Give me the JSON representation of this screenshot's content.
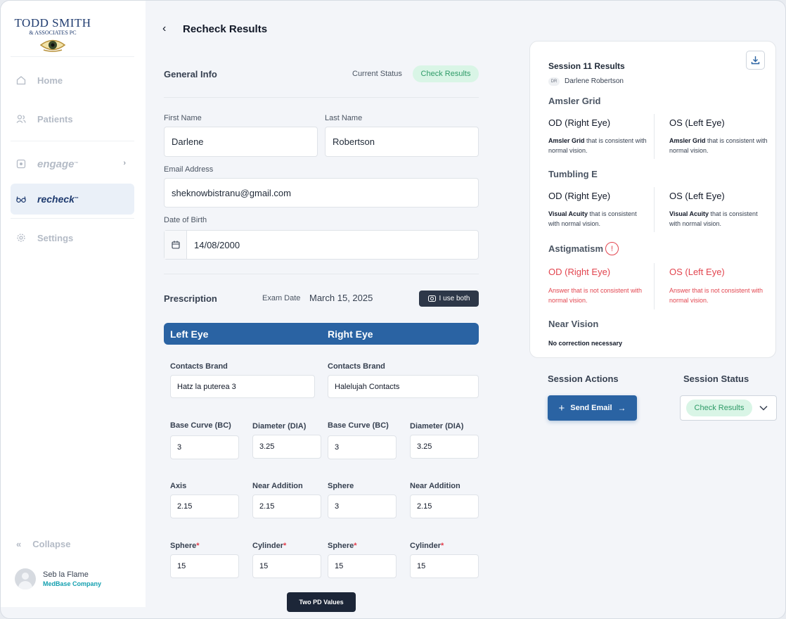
{
  "logo": {
    "line1": "TODD SMITH",
    "line2": "& ASSOCIATES PC"
  },
  "sidebar": {
    "items": [
      {
        "label": "Home"
      },
      {
        "label": "Patients"
      },
      {
        "label": "engage"
      },
      {
        "label": "recheck"
      },
      {
        "label": "Settings"
      }
    ],
    "collapse_label": "Collapse",
    "user": {
      "name": "Seb la Flame",
      "company": "MedBase Company"
    }
  },
  "header": {
    "title": "Recheck Results"
  },
  "general": {
    "title": "General Info",
    "status_label": "Current Status",
    "status_value": "Check Results",
    "first_name_label": "First Name",
    "first_name": "Darlene",
    "last_name_label": "Last Name",
    "last_name": "Robertson",
    "email_label": "Email Address",
    "email": "sheknowbistranu@gmail.com",
    "dob_label": "Date of Birth",
    "dob": "14/08/2000"
  },
  "prescription": {
    "title": "Prescription",
    "exam_label": "Exam Date",
    "exam_date": "March 15, 2025",
    "use_both": "I use both",
    "left_eye": "Left Eye",
    "right_eye": "Right Eye",
    "left": {
      "contacts_brand": "Hatz la puterea 3",
      "base_curve": "3",
      "diameter": "3.25",
      "axis": "2.15",
      "near_addition": "2.15",
      "sphere": "15",
      "cylinder": "15"
    },
    "right": {
      "contacts_brand": "Halelujah Contacts",
      "base_curve": "3",
      "diameter": "3.25",
      "sphere_top": "3",
      "near_addition": "2.15",
      "sphere": "15",
      "cylinder": "15"
    },
    "labels": {
      "contacts_brand": "Contacts Brand",
      "base_curve": "Base Curve (BC)",
      "diameter": "Diameter (DIA)",
      "axis": "Axis",
      "near_addition": "Near Addition",
      "sphere": "Sphere",
      "cylinder": "Cylinder",
      "required": "*"
    },
    "pd_button": "Two PD Values"
  },
  "session": {
    "title": "Session 11 Results",
    "initials": "DR",
    "patient": "Darlene Robertson",
    "od": "OD (Right Eye)",
    "os": "OS (Left Eye)",
    "amsler": {
      "title": "Amsler Grid",
      "bold": "Amsler Grid",
      "text": " that is consistent with normal vision."
    },
    "tumbling": {
      "title": "Tumbling E",
      "bold": "Visual Acuity",
      "text": " that is consistent with normal vision."
    },
    "astig": {
      "title": "Astigmatism",
      "warn": "!",
      "text": "Answer that is not consistent with normal vision."
    },
    "near": {
      "title": "Near Vision",
      "text": "No correction necessary"
    },
    "actions_title": "Session Actions",
    "send_email": "Send Email",
    "status_title": "Session Status",
    "status_value": "Check Results"
  },
  "colors": {
    "primary": "#2a63a3",
    "status_green_bg": "#d9f5e6",
    "status_green_text": "#2f9b68",
    "error": "#e2454f"
  }
}
